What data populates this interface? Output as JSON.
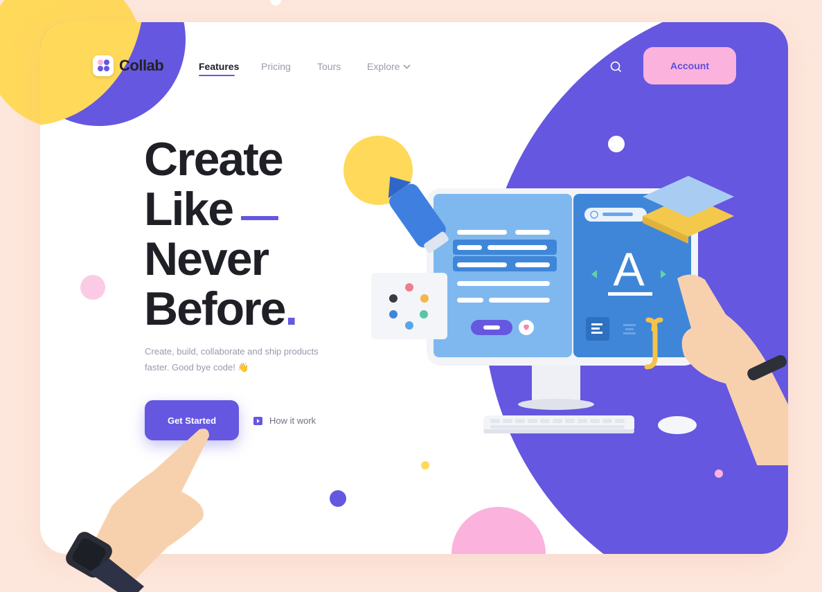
{
  "brand": {
    "name": "Collab",
    "period": "."
  },
  "nav": {
    "items": [
      {
        "label": "Features",
        "active": true
      },
      {
        "label": "Pricing",
        "active": false
      },
      {
        "label": "Tours",
        "active": false
      },
      {
        "label": "Explore",
        "active": false,
        "icon": "chevron-down-icon"
      }
    ],
    "search_icon": "search-icon",
    "account_label": "Account"
  },
  "hero": {
    "title_lines": [
      "Create",
      "Like",
      "Never",
      "Before"
    ],
    "title_period": ".",
    "subtitle": "Create, build, collaborate and ship products faster. Good bye code! 👋",
    "cta_label": "Get Started",
    "secondary_label": "How it work",
    "secondary_icon": "play-icon"
  },
  "illustration": {
    "editor_letter": "A",
    "colors": {
      "accent": "#6557e0",
      "pink": "#fbb2dd",
      "yellow": "#ffd95a",
      "screen_blue": "#5b9ee8",
      "background": "#fde7dc"
    }
  }
}
